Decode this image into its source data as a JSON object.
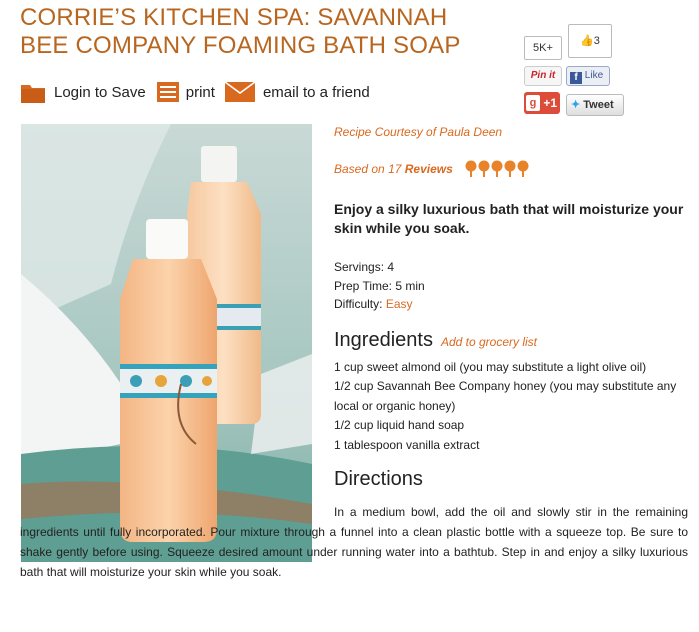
{
  "page": {
    "title": "CORRIE’S KITCHEN SPA: SAVANNAH BEE COMPANY FOAMING BATH SOAP"
  },
  "actions": {
    "login": "Login to Save",
    "print": "print",
    "email": "email to a friend"
  },
  "social": {
    "pin_count": "5K+",
    "pin_label": "Pin it",
    "like_count": "3",
    "like_label": "Like",
    "gplus_label": "+1",
    "tweet_label": "Tweet"
  },
  "recipe": {
    "courtesy_prefix": "Recipe Courtesy of",
    "courtesy_author": "Paula Deen",
    "based_on": "Based on",
    "review_count": "17",
    "reviews_label": "Reviews",
    "rating": 5,
    "rating_max": 5,
    "summary": "Enjoy a silky luxurious bath that will moisturize your skin while you soak.",
    "servings_label": "Servings:",
    "servings": "4",
    "prep_label": "Prep Time:",
    "prep": "5 min",
    "difficulty_label": "Difficulty:",
    "difficulty": "Easy",
    "ingredients_heading": "Ingredients",
    "grocery_link": "Add to grocery list",
    "ingredients": [
      "1 cup sweet almond oil (you may substitute a light olive oil)",
      "1/2 cup Savannah Bee Company honey (you may substitute any local or organic honey)",
      "1/2 cup liquid hand soap",
      "1 tablespoon vanilla extract"
    ],
    "directions_heading": "Directions",
    "directions": "In a medium bowl, add the oil and slowly stir in the remaining ingredients until fully incorporated. Pour mixture through a funnel into a clean plastic bottle with a squeeze top. Be sure to shake gently before using. Squeeze desired amount under running water into a bathtub. Step in and enjoy a silky luxurious bath that will moisturize your skin while you soak."
  },
  "colors": {
    "title": "#b8661f",
    "accent": "#d9691f",
    "star": "#e8832a"
  }
}
